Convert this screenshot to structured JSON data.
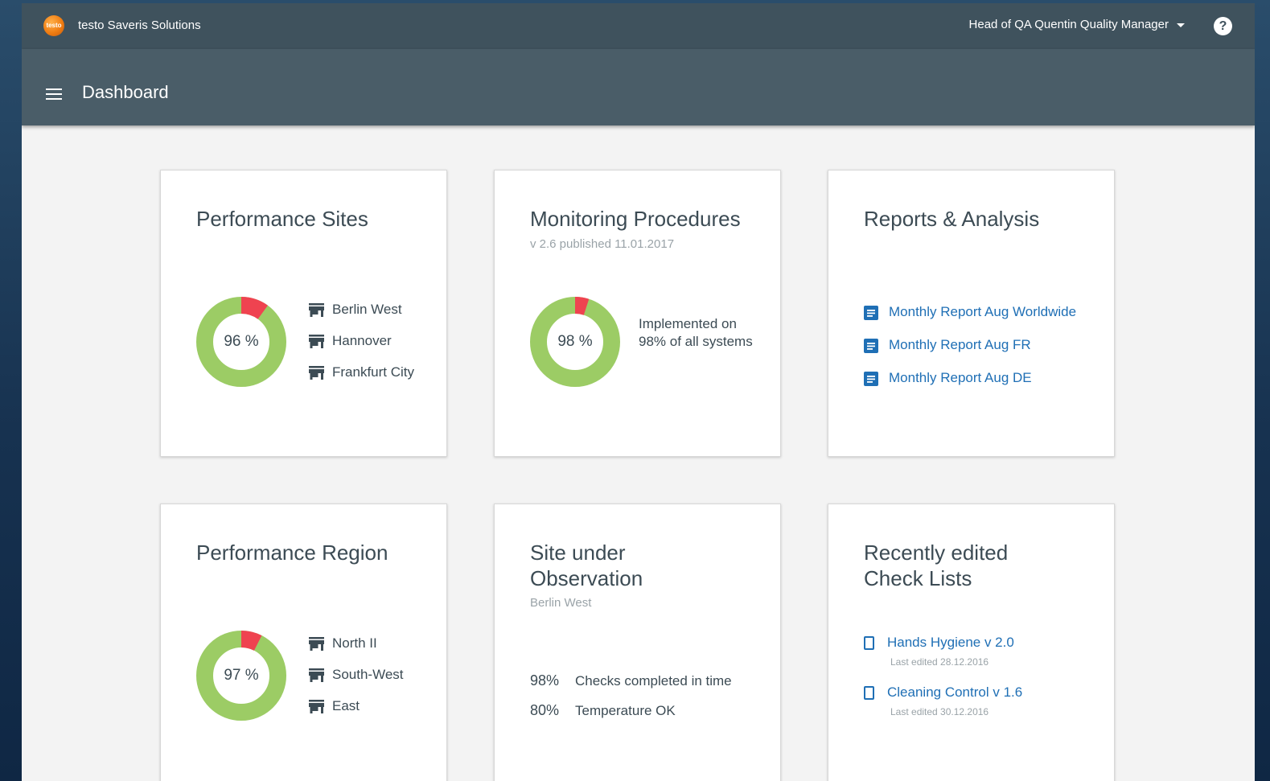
{
  "header": {
    "logo_text": "testo",
    "app_title": "testo Saveris Solutions",
    "user_label": "Head of QA Quentin Quality Manager",
    "help_label": "?"
  },
  "subheader": {
    "page_title": "Dashboard"
  },
  "cards": {
    "performance_sites": {
      "title": "Performance Sites",
      "percent": 96,
      "percent_label": "96 %",
      "sites": [
        "Berlin West",
        "Hannover",
        "Frankfurt City"
      ]
    },
    "monitoring": {
      "title": "Monitoring Procedures",
      "subtitle": "v 2.6 published 11.01.2017",
      "percent": 98,
      "percent_label": "98 %",
      "description": "Implemented on 98% of all systems"
    },
    "reports": {
      "title": "Reports & Analysis",
      "links": [
        "Monthly Report Aug Worldwide",
        "Monthly Report Aug FR",
        "Monthly Report Aug DE"
      ]
    },
    "performance_region": {
      "title": "Performance Region",
      "percent": 97,
      "percent_label": "97 %",
      "regions": [
        "North II",
        "South-West",
        "East"
      ]
    },
    "site_observation": {
      "title": "Site under Observation",
      "subtitle": "Berlin West",
      "stats": [
        {
          "value": "98%",
          "label": "Checks completed in time"
        },
        {
          "value": "80%",
          "label": "Temperature OK"
        }
      ]
    },
    "check_lists": {
      "title": "Recently edited Check Lists",
      "items": [
        {
          "name": "Hands Hygiene v 2.0",
          "edited": "Last edited 28.12.2016"
        },
        {
          "name": "Cleaning Control v 1.6",
          "edited": "Last edited 30.12.2016"
        }
      ]
    }
  },
  "colors": {
    "donut_good": "#9ccc65",
    "donut_bad": "#ef4350",
    "link": "#1f6fb5"
  },
  "icons": {
    "site": "store-icon",
    "report": "document-icon",
    "checklist": "phone-icon"
  }
}
